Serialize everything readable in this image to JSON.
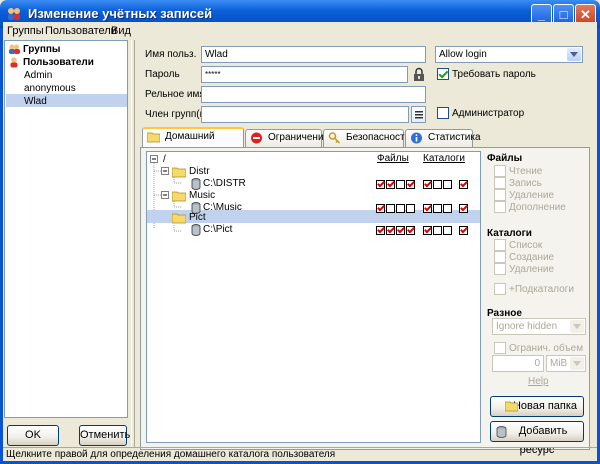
{
  "window": {
    "title": "Изменение учётных записей"
  },
  "menu": [
    "Группы",
    "Пользователи",
    "Вид"
  ],
  "left_tree": {
    "groups_label": "Группы",
    "users_label": "Пользователи",
    "users": [
      "Admin",
      "anonymous",
      "Wlad"
    ],
    "selected": "Wlad"
  },
  "buttons": {
    "ok": "OK",
    "cancel": "Отменить",
    "new_folder": "Новая папка",
    "add_resource": "Добавить ресурс"
  },
  "form": {
    "username_label": "Имя польз.",
    "username_value": "Wlad",
    "password_label": "Пароль",
    "password_value": "*****",
    "realname_label": "Рельное имя",
    "realname_value": "",
    "memberof_label": "Член групп(ы)",
    "memberof_value": "",
    "login_select": "Allow login",
    "require_password_label": "Требовать пароль",
    "require_password_checked": true,
    "admin_label": "Администратор",
    "admin_checked": false
  },
  "tabs": [
    "Домашний каталог",
    "Ограничения",
    "Безопасность",
    "Статистика"
  ],
  "active_tab": "Домашний каталог",
  "dir_tree": {
    "root": "/",
    "files_header": "Файлы",
    "dirs_header": "Каталоги",
    "rows": [
      {
        "label": "Distr",
        "type": "folder",
        "files": [],
        "dirs": []
      },
      {
        "label": "C:\\DISTR",
        "type": "drive",
        "files": [
          true,
          true,
          false,
          true
        ],
        "dirs": [
          true,
          false,
          false,
          true
        ]
      },
      {
        "label": "Music",
        "type": "folder",
        "files": [],
        "dirs": []
      },
      {
        "label": "C:\\Music",
        "type": "drive",
        "files": [
          true,
          false,
          false,
          false
        ],
        "dirs": [
          true,
          false,
          false,
          true
        ]
      },
      {
        "label": "Pict",
        "type": "folder",
        "files": [],
        "dirs": [],
        "selected": true
      },
      {
        "label": "C:\\Pict",
        "type": "drive",
        "files": [
          true,
          true,
          true,
          true
        ],
        "dirs": [
          true,
          false,
          false,
          true
        ]
      }
    ]
  },
  "right_panel": {
    "files_section": "Файлы",
    "files_options": [
      "Чтение",
      "Запись",
      "Удаление",
      "Дополнение"
    ],
    "dirs_section": "Каталоги",
    "dirs_options": [
      "Список",
      "Создание",
      "Удаление"
    ],
    "subdirs_label": "+Подкаталоги",
    "misc_section": "Разное",
    "hidden_select": "Ignore hidden",
    "limit_label": "Огранич. объем",
    "limit_value": "0",
    "limit_unit": "MiB",
    "help_link": "Help"
  },
  "status_text": "Щелкните правой для определения домашнего каталога пользователя",
  "colors": {
    "title_bar": "#0a5fd8",
    "selection": "#316ac5",
    "row_highlight": "#c1d2ee",
    "check_red": "#e00000"
  }
}
